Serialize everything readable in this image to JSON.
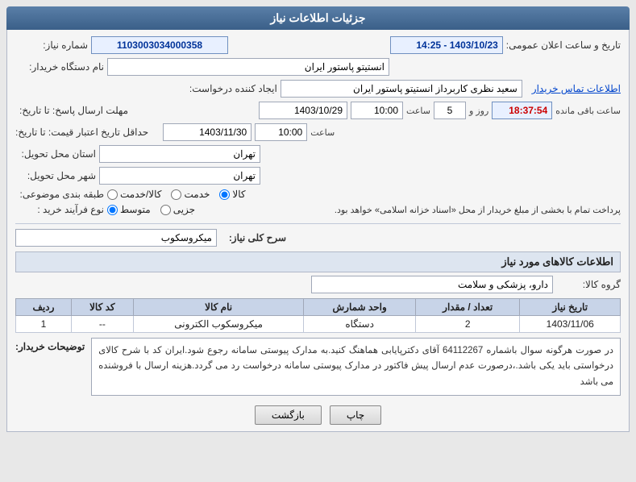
{
  "header": {
    "title": "جزئیات اطلاعات نیاز"
  },
  "fields": {
    "shomara_niaz_label": "شماره نیاز:",
    "shomara_niaz_value": "1103003034000358",
    "tarikh_label": "تاریخ و ساعت اعلان عمومی:",
    "tarikh_value": "1403/10/23 - 14:25",
    "name_dastgah_label": "نام دستگاه خریدار:",
    "name_dastgah_value": "انستیتو پاستور ایران",
    "ijad_label": "ایجاد کننده درخواست:",
    "ijad_value": "سعید نظری کاربرداز انستیتو پاستور ایران",
    "ettelaat_link": "اطلاعات تماس خریدار",
    "mohlat_label": "مهلت ارسال پاسخ: تا تاریخ:",
    "mohlat_date": "1403/10/29",
    "mohlat_time": "10:00",
    "mohlat_rooz": "5",
    "mohlat_saaat": "18:37:54",
    "mohlat_rooz_label": "روز و",
    "mohlat_saaat_label": "ساعت باقی مانده",
    "hadaghal_label": "حداقل تاریخ اعتبار قیمت: تا تاریخ:",
    "hadaghal_date": "1403/11/30",
    "hadaghal_time": "10:00",
    "ostan_label": "استان محل تحویل:",
    "ostan_value": "تهران",
    "shahr_label": "شهر محل تحویل:",
    "shahr_value": "تهران",
    "tabaghe_label": "طبقه بندی موضوعی:",
    "tabaghe_options": [
      "کالا",
      "خدمت",
      "کالا/خدمت"
    ],
    "tabaghe_selected": "کالا",
    "nav_farayand_label": "نوع فرآیند خرید :",
    "nav_farayand_options": [
      "جزیی",
      "متوسط"
    ],
    "nav_farayand_selected": "متوسط",
    "nav_farayand_note": "پرداخت تمام با بخشی از مبلغ خریدار از محل «اسناد خزانه اسلامی» خواهد بود.",
    "sarh_label": "سرح کلی نیاز:",
    "sarh_value": "میکروسکوب",
    "etelaat_section": "اطلاعات کالاهای مورد نیاز",
    "goroh_label": "گروه کالا:",
    "goroh_value": "دارو، پزشکی و سلامت",
    "table": {
      "headers": [
        "ردیف",
        "کد کالا",
        "نام کالا",
        "واحد شمارش",
        "تعداد / مقدار",
        "تاریخ نیاز"
      ],
      "rows": [
        {
          "radif": "1",
          "kod_kala": "--",
          "name_kala": "میکروسکوب الکترونی",
          "vahed": "دستگاه",
          "tedad": "2",
          "tarikh": "1403/11/06"
        }
      ]
    },
    "toseeat_label": "توضیحات خریدار:",
    "toseeat_value": "در صورت هرگونه سوال باشماره 64112267 آقای دکترپایابی هماهنگ کنید.به مدارک پیوستی سامانه رجوع شود.ایران کد با شرح کالای درخواستی باید یکی باشد.،درصورت عدم ارسال پیش فاکتور در مدارک پیوستی سامانه درخواست رد می گردد.هزینه ارسال با فروشنده می باشد",
    "btn_bazgasht": "بازگشت",
    "btn_chap": "چاپ"
  }
}
